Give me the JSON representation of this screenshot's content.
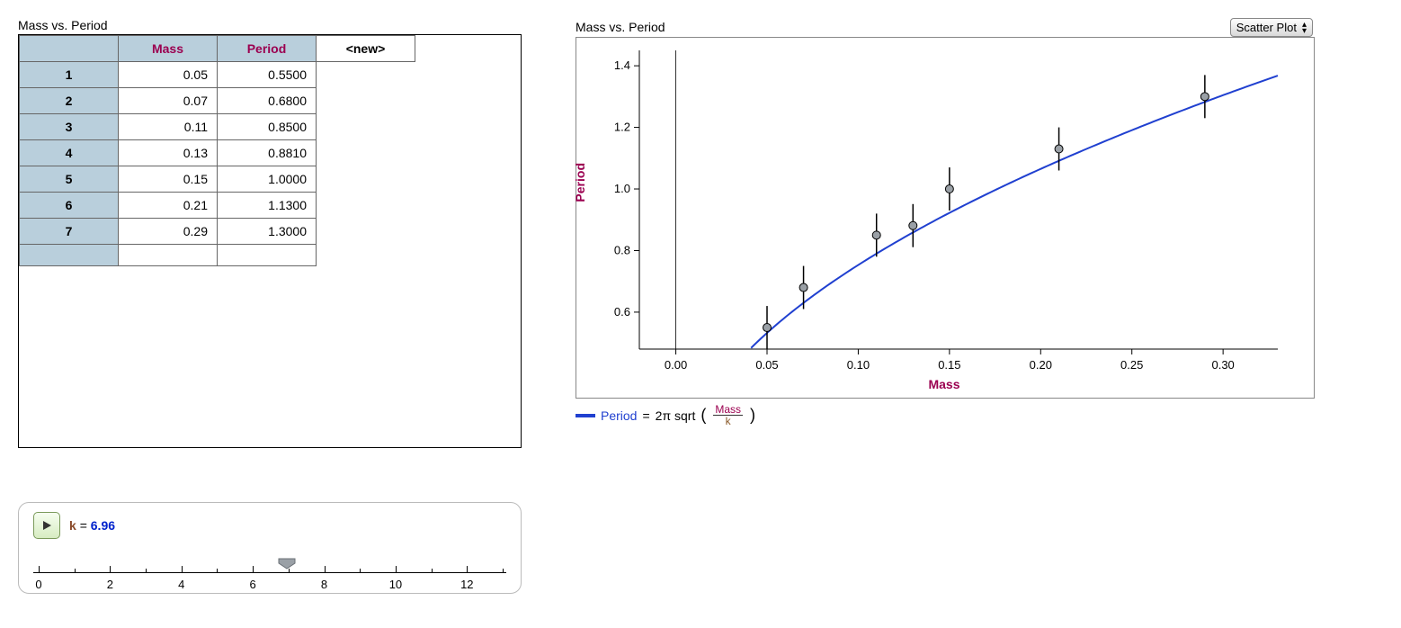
{
  "tablePanel": {
    "title": "Mass vs. Period",
    "columns": [
      "Mass",
      "Period"
    ],
    "newColLabel": "<new>",
    "rows": [
      {
        "n": "1",
        "mass": "0.05",
        "period": "0.5500"
      },
      {
        "n": "2",
        "mass": "0.07",
        "period": "0.6800"
      },
      {
        "n": "3",
        "mass": "0.11",
        "period": "0.8500"
      },
      {
        "n": "4",
        "mass": "0.13",
        "period": "0.8810"
      },
      {
        "n": "5",
        "mass": "0.15",
        "period": "1.0000"
      },
      {
        "n": "6",
        "mass": "0.21",
        "period": "1.1300"
      },
      {
        "n": "7",
        "mass": "0.29",
        "period": "1.3000"
      }
    ]
  },
  "slider": {
    "paramName": "k",
    "equals": "=",
    "value": "6.96",
    "min": 0,
    "max": 13,
    "majorTicks": [
      0,
      2,
      4,
      6,
      8,
      10,
      12
    ]
  },
  "chartPanel": {
    "title": "Mass vs. Period",
    "dropdownLabel": "Scatter Plot",
    "xlabel": "Mass",
    "ylabel": "Period"
  },
  "legendParts": {
    "periodWord": "Period",
    "equals": " = ",
    "prefix": "2π sqrt",
    "lparen": "(",
    "fracTop": "Mass",
    "fracBot": "k",
    "rparen": ")"
  },
  "chart_data": {
    "type": "scatter",
    "title": "Mass vs. Period",
    "xlabel": "Mass",
    "ylabel": "Period",
    "xlim": [
      -0.02,
      0.33
    ],
    "ylim": [
      0.48,
      1.45
    ],
    "xticks": [
      0.0,
      0.05,
      0.1,
      0.15,
      0.2,
      0.25,
      0.3
    ],
    "yticks": [
      0.6,
      0.8,
      1.0,
      1.2,
      1.4
    ],
    "series": [
      {
        "name": "data",
        "style": "points-with-error",
        "points": [
          {
            "x": 0.05,
            "y": 0.55
          },
          {
            "x": 0.07,
            "y": 0.68
          },
          {
            "x": 0.11,
            "y": 0.85
          },
          {
            "x": 0.13,
            "y": 0.881
          },
          {
            "x": 0.15,
            "y": 1.0
          },
          {
            "x": 0.21,
            "y": 1.13
          },
          {
            "x": 0.29,
            "y": 1.3
          }
        ],
        "yerr": 0.07
      },
      {
        "name": "fit",
        "style": "line",
        "formula": "Period = 2*pi*sqrt(Mass/k)",
        "k": 6.96,
        "color": "#2040d0"
      }
    ]
  }
}
